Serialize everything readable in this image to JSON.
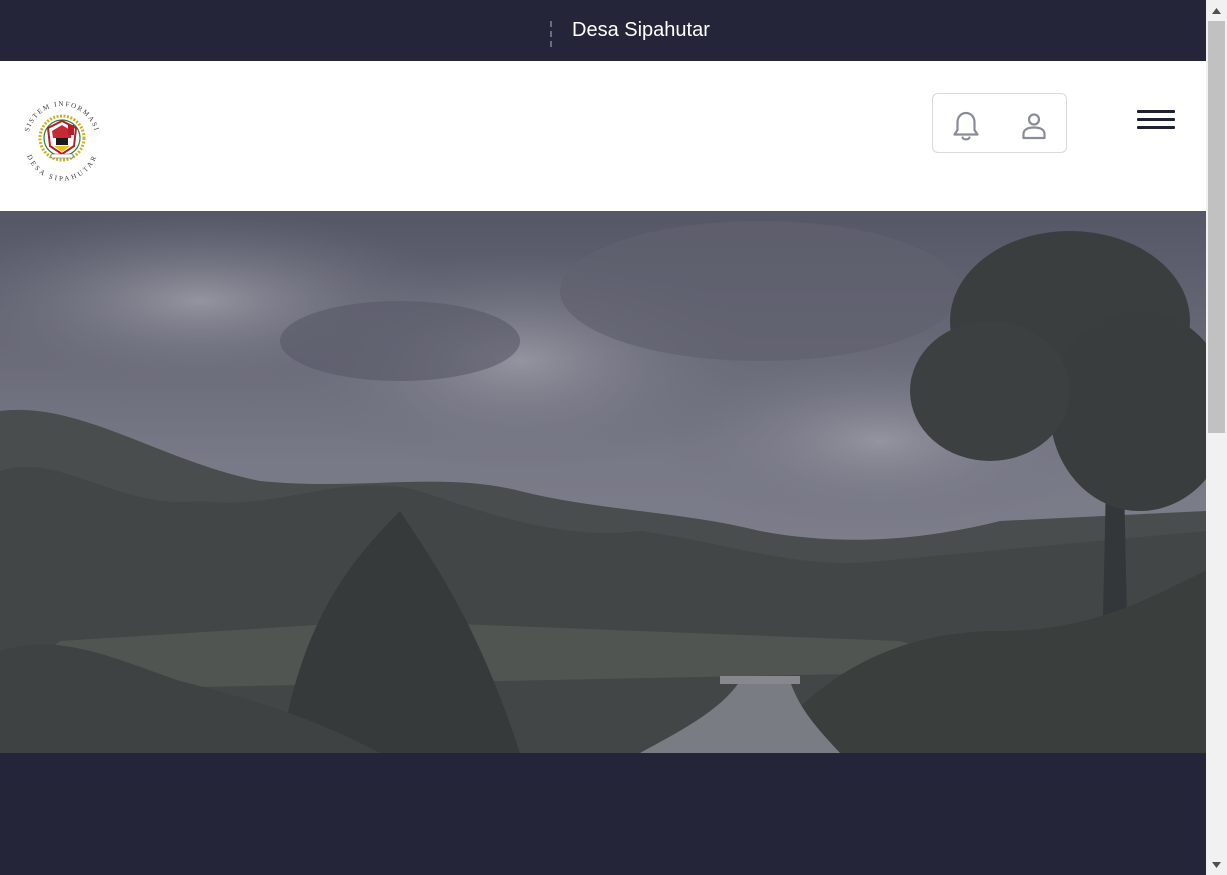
{
  "topbar": {
    "site_name": "Desa Sipahutar"
  },
  "header": {
    "logo": {
      "top_text": "SISTEM INFORMASI",
      "bottom_text": "DESA SIPAHUTAR"
    },
    "icons": {
      "notification": "bell-icon",
      "account": "user-icon",
      "menu": "hamburger-menu-icon"
    }
  },
  "colors": {
    "dark_navy": "#242538",
    "header_bg": "#ffffff",
    "icon_stroke": "#8a8b99",
    "hero_overlay": "rgba(36,37,56,0.45)"
  }
}
